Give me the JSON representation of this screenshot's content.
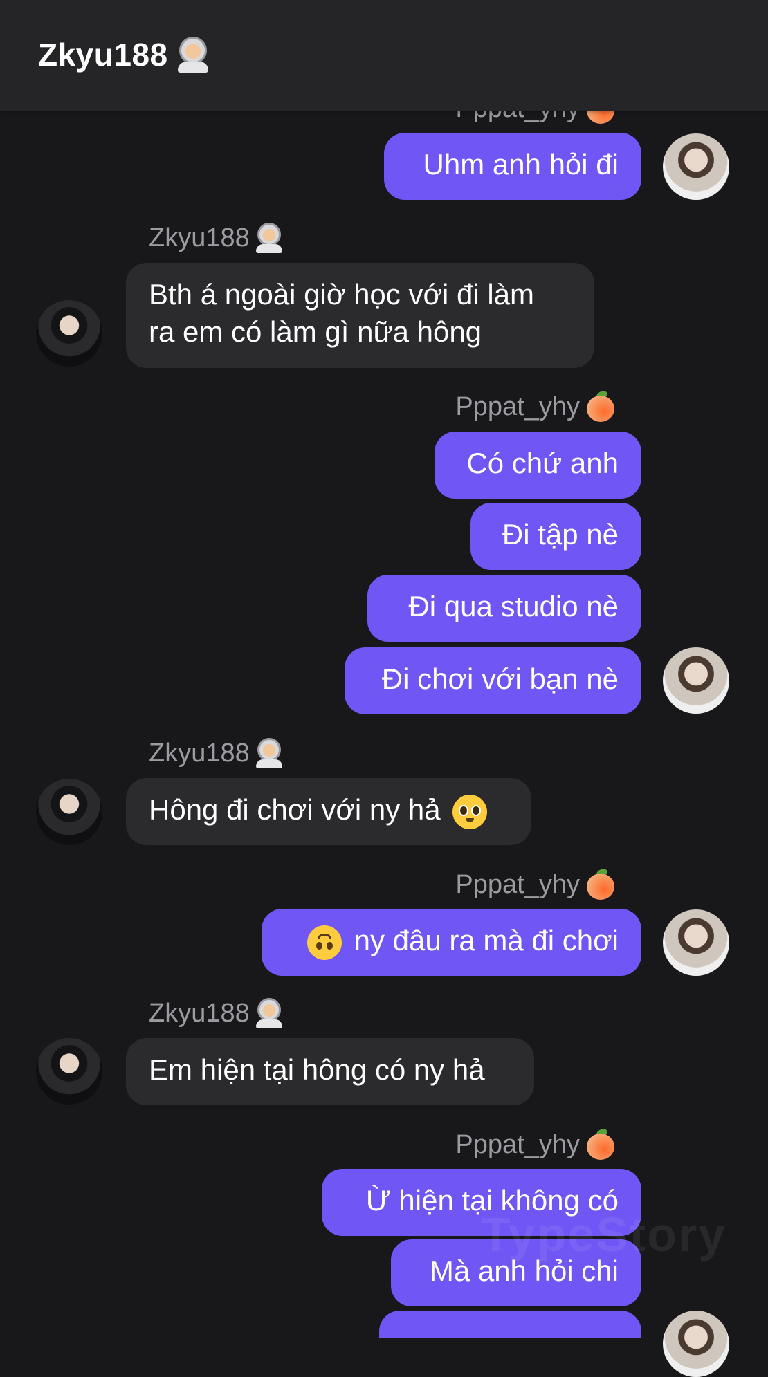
{
  "header": {
    "title": "Zkyu188",
    "title_emoji_icon": "astronaut-icon"
  },
  "names": {
    "me": "Pppat_yhy",
    "them": "Zkyu188"
  },
  "messages": [
    {
      "from": "me",
      "text": "Uhm anh hỏi đi"
    },
    {
      "from": "them",
      "lines": [
        "Bth á ngoài giờ học với đi làm",
        "ra em có làm gì nữa hông"
      ]
    },
    {
      "from": "me",
      "text": "Có chứ anh"
    },
    {
      "from": "me",
      "text": "Đi tập nè"
    },
    {
      "from": "me",
      "text": "Đi qua studio nè"
    },
    {
      "from": "me",
      "text": "Đi chơi với bạn nè"
    },
    {
      "from": "them",
      "text": "Hông đi chơi với ny hả",
      "emoji": "pleading-face-icon"
    },
    {
      "from": "me",
      "text": "ny đâu ra mà đi chơi",
      "emoji": "upside-down-face-icon"
    },
    {
      "from": "them",
      "text": "Em hiện tại hông có ny hả"
    },
    {
      "from": "me",
      "text": "Ừ hiện tại không có"
    },
    {
      "from": "me",
      "text": "Mà anh hỏi chi"
    }
  ],
  "watermark": "TypeStory",
  "colors": {
    "background": "#18181b",
    "header": "#252527",
    "me_bubble": "#7057f5",
    "them_bubble": "#2b2b2e",
    "name_text": "#9b9ba1"
  }
}
